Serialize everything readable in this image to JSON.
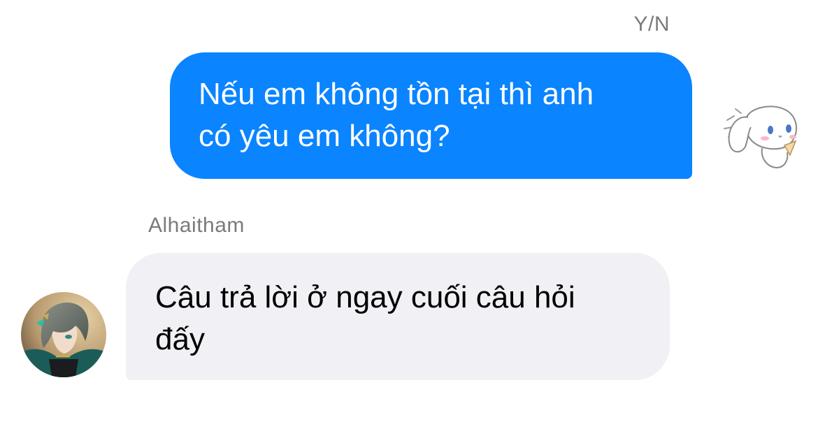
{
  "conversation": {
    "outgoing": {
      "sender": "Y/N",
      "message_line1": "Nếu em không tồn tại thì anh",
      "message_line2": "có yêu em không?",
      "bubble_color": "#0a84ff",
      "avatar_icon": "cinnamoroll-sticker-icon"
    },
    "incoming": {
      "sender": "Alhaitham",
      "message_line1": "Câu trả lời ở ngay cuối câu hỏi",
      "message_line2": "đấy",
      "bubble_color": "#f0f0f5",
      "avatar_icon": "anime-character-avatar"
    }
  }
}
